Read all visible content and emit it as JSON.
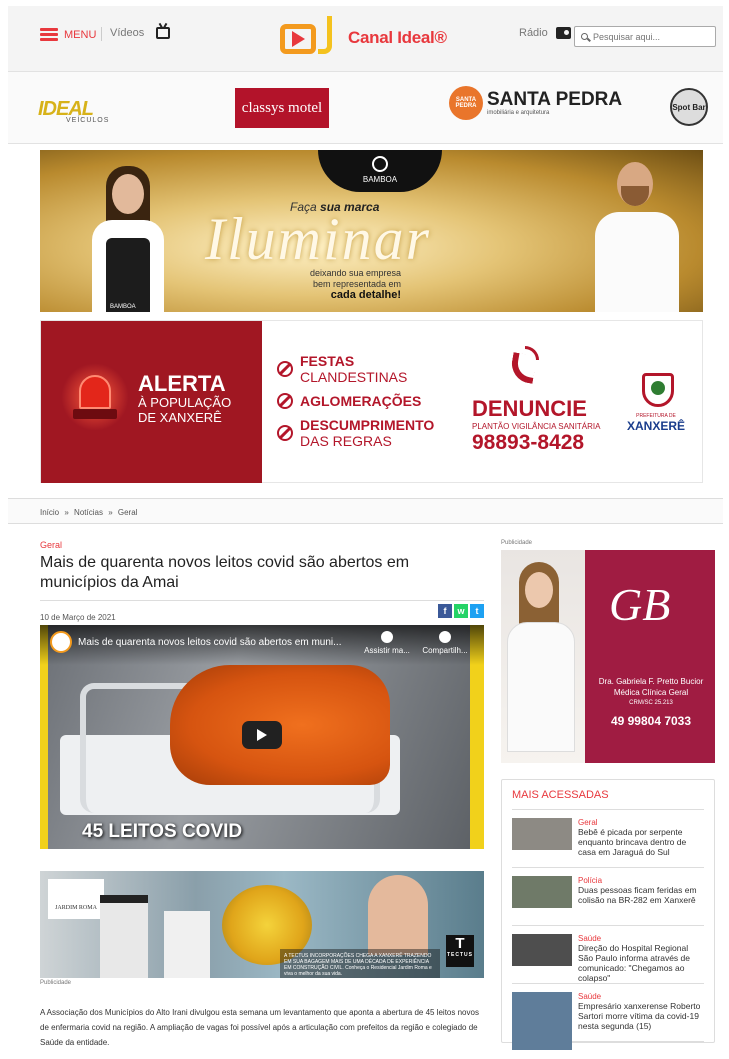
{
  "header": {
    "menu_label": "MENU",
    "videos_label": "Vídeos",
    "logo_text": "Canal Ideal®",
    "radio_label": "Rádio",
    "search_placeholder": "Pesquisar aqui..."
  },
  "partners": {
    "ideal": "IDEAL",
    "ideal_sub": "VEÍCULOS",
    "classys": "classys motel",
    "santa_badge": "SANTA PEDRA",
    "santa_name": "SANTA PEDRA",
    "santa_sub": "imobiliária e arquitetura",
    "spot": "Spot Bar"
  },
  "banner1": {
    "brand": "BAMBOA",
    "lead_a": "Faça",
    "lead_b": "sua marca",
    "headline": "Iluminar",
    "sub1": "deixando sua empresa",
    "sub2": "bem representada em",
    "sub3": "cada detalhe!",
    "apron": "BAMBOA"
  },
  "banner2": {
    "alerta": "ALERTA",
    "alerta_sub1": "À POPULAÇÃO",
    "alerta_sub2": "DE XANXERÊ",
    "items": [
      {
        "bold": "FESTAS",
        "rest": "CLANDESTINAS"
      },
      {
        "bold": "AGLOMERAÇÕES",
        "rest": ""
      },
      {
        "bold": "DESCUMPRIMENTO",
        "rest": "DAS REGRAS"
      }
    ],
    "denuncie": "DENUNCIE",
    "plantao": "PLANTÃO VIGILÂNCIA SANITÁRIA",
    "phone": "98893-8428",
    "pref": "PREFEITURA DE",
    "city": "XANXERÊ"
  },
  "breadcrumb": [
    "Início",
    "»",
    "Notícias",
    "»",
    "Geral"
  ],
  "article": {
    "category": "Geral",
    "title": "Mais de quarenta novos leitos covid são abertos em municípios da Amai",
    "date": "10 de Março de 2021",
    "share": {
      "facebook": "f",
      "whatsapp": "w",
      "twitter": "t"
    },
    "video": {
      "title": "Mais de quarenta novos leitos covid são abertos em muni...",
      "watch_later": "Assistir ma...",
      "share": "Compartilh...",
      "caption": "45 LEITOS COVID"
    },
    "ad": {
      "jardim": "JARDIM ROMA",
      "dark_text": "A TECTUS INCORPORAÇÕES CHEGA A XANXERÊ TRAZENDO EM SUA BAGAGEM MAIS DE UMA DÉCADA DE EXPERIÊNCIA EM CONSTRUÇÃO CIVIL. Conheça o Residencial Jardim Roma e viva o melhor da sua vida.",
      "logo": "T",
      "logo_sub": "TECTUS"
    },
    "pub_label": "Publicidade",
    "body": "A Associação dos Municípios do Alto Irani divulgou esta semana um levantamento que aponta a abertura de 45 leitos novos de enfermaria covid na região. A ampliação de vagas foi possível após a articulação com prefeitos da região e colegiado de Saúde da entidade."
  },
  "sidebar": {
    "pub_label": "Publicidade",
    "ad": {
      "monogram": "GB",
      "name": "Dra. Gabriela F. Pretto Bucior",
      "role": "Médica Clínica Geral",
      "crm": "CRM/SC 25.213",
      "phone": "49 99804 7033"
    },
    "mais_title": "MAIS ACESSADAS",
    "mais": [
      {
        "cat": "Geral",
        "headline": "Bebê é picada por serpente enquanto brincava dentro de casa em Jaraguá do Sul",
        "thumb": "#8d8a84"
      },
      {
        "cat": "Polícia",
        "headline": "Duas pessoas ficam feridas em colisão na BR-282 em Xanxerê",
        "thumb": "#6f7a68"
      },
      {
        "cat": "Saúde",
        "headline": "Direção do Hospital Regional São Paulo informa através de comunicado: \"Chegamos ao colapso\"",
        "thumb": "#4e4e4e"
      },
      {
        "cat": "Saúde",
        "headline": "Empresário xanxerense Roberto Sartori morre vítima da covid-19 nesta segunda (15)",
        "thumb": "#5f7d9a"
      }
    ]
  },
  "colors": {
    "accent": "#e8383d",
    "alert_red": "#a01722",
    "facebook": "#3b5998",
    "whatsapp": "#25d366",
    "twitter": "#1da1f2"
  }
}
